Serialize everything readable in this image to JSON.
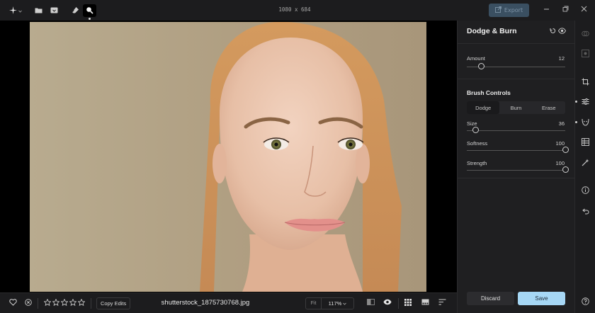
{
  "toolbar": {
    "dimensions": "1080 x 684",
    "export_label": "Export",
    "icons": [
      "sparkle-icon",
      "chevron-down-icon",
      "folder-icon",
      "image-import-icon",
      "eraser-icon",
      "dodge-burn-icon",
      "minimize-icon",
      "restore-icon",
      "close-icon"
    ]
  },
  "panel": {
    "title": "Dodge & Burn",
    "amount": {
      "label": "Amount",
      "value": "12",
      "fraction": 0.15
    },
    "brush_controls_title": "Brush Controls",
    "modes": [
      "Dodge",
      "Burn",
      "Erase"
    ],
    "selected_mode": "Dodge",
    "size": {
      "label": "Size",
      "value": "36",
      "fraction": 0.09
    },
    "softness": {
      "label": "Softness",
      "value": "100",
      "fraction": 1.0
    },
    "strength": {
      "label": "Strength",
      "value": "100",
      "fraction": 1.0
    },
    "discard_label": "Discard",
    "save_label": "Save"
  },
  "bottom": {
    "copy_label": "Copy Edits",
    "filename": "shutterstock_1875730768.jpg",
    "fit_label": "Fit",
    "zoom_label": "117%",
    "stars": 5
  },
  "colors": {
    "accent_save": "#a6d7f5",
    "export_bg": "#3a4f61",
    "panel_bg": "#1f1f21",
    "app_bg": "#1c1c1e"
  }
}
